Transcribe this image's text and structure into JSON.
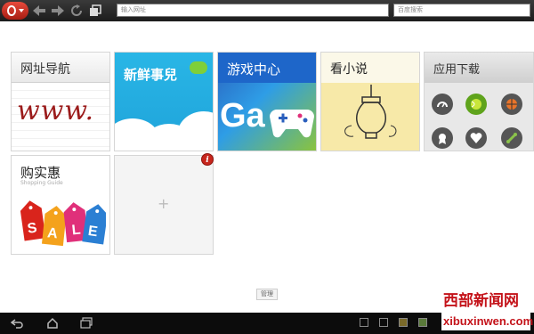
{
  "browser": {
    "url_placeholder": "输入网址",
    "search_placeholder": "百度搜索"
  },
  "speed_dial": {
    "tiles": [
      {
        "title": "网址导航",
        "art_text": "www."
      },
      {
        "title": "新鲜事兒"
      },
      {
        "title": "游戏中心",
        "art_text": "Ga"
      },
      {
        "title": "看小说"
      },
      {
        "title": "应用下载"
      },
      {
        "title": "购实惠",
        "subtitle": "Shopping Guide",
        "art_letters": [
          "S",
          "A",
          "L",
          "E"
        ]
      },
      {
        "title": "",
        "add_symbol": "+"
      }
    ],
    "info_badge": "i",
    "manage_label": "管理"
  },
  "watermark": {
    "name": "西部新闻网",
    "url": "xibuxinwen.com"
  },
  "colors": {
    "accent_red": "#c4131a",
    "sky_blue": "#29b6e6",
    "game_blue": "#1e66c9",
    "note_yellow": "#f7e9a8"
  }
}
